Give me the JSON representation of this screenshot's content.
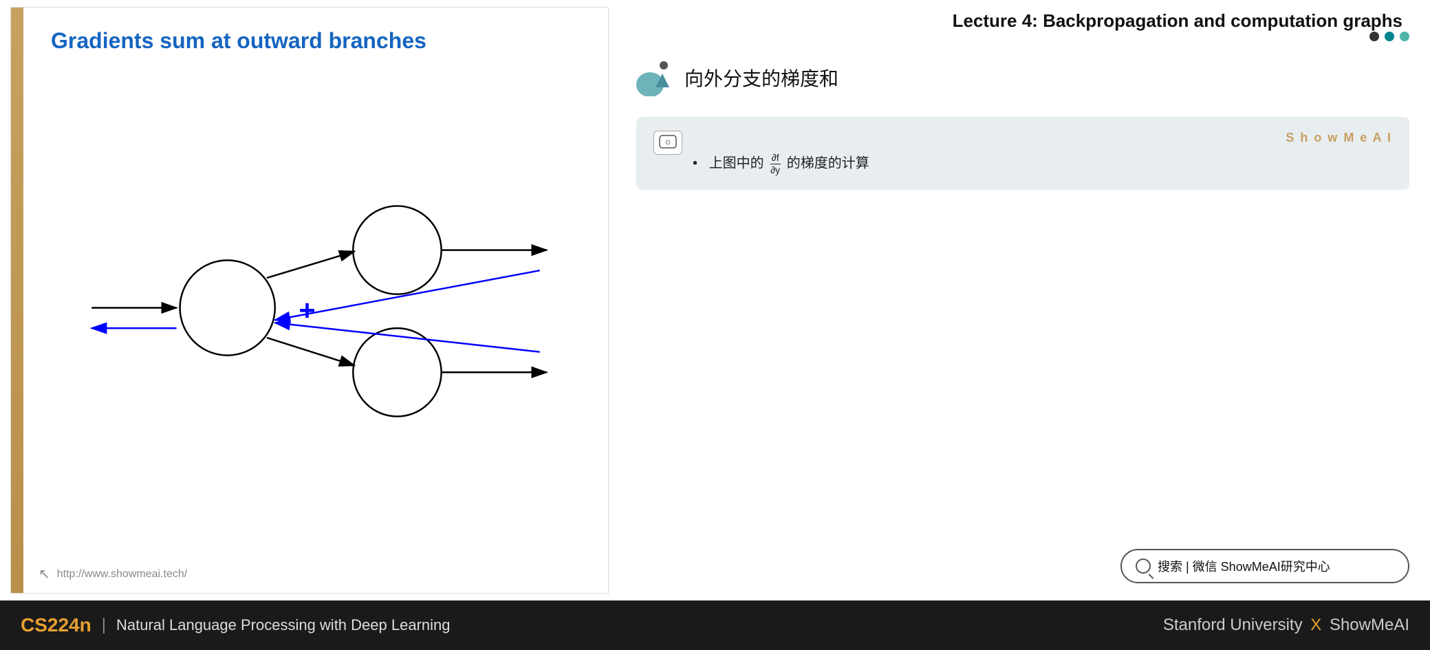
{
  "slide": {
    "title": "Gradients sum at outward branches",
    "footer_url": "http://www.showmeai.tech/",
    "left_bar_color": "#c8a060"
  },
  "lecture": {
    "title": "Lecture 4:   Backpropagation and computation graphs"
  },
  "section": {
    "title": "向外分支的梯度和",
    "dot1": "dark",
    "dot2": "teal",
    "dot3": "light-teal"
  },
  "card": {
    "badge": "⊙",
    "brand": "S h o w M e A I",
    "bullet": "•",
    "text_prefix": "上图中的",
    "fraction_num": "∂f",
    "fraction_den": "∂y",
    "text_suffix": "的梯度的计算"
  },
  "search": {
    "placeholder": "搜索 | 微信 ShowMeAI研究中心"
  },
  "footer": {
    "course_code": "CS224n",
    "separator": "|",
    "course_name": "Natural Language Processing with Deep Learning",
    "university": "Stanford University",
    "x": "X",
    "brand": "ShowMeAI"
  }
}
